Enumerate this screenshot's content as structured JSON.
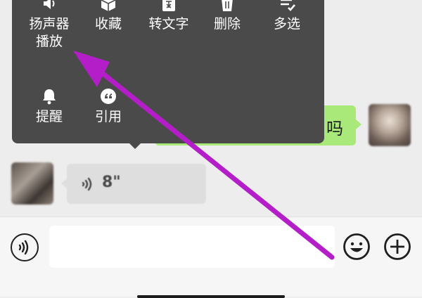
{
  "context_menu": {
    "items": [
      {
        "label": "扬声器\n播放",
        "icon": "speaker-icon"
      },
      {
        "label": "收藏",
        "icon": "cube-icon"
      },
      {
        "label": "转文字",
        "icon": "text-doc-icon"
      },
      {
        "label": "删除",
        "icon": "trash-icon"
      },
      {
        "label": "多选",
        "icon": "checklist-icon"
      },
      {
        "label": "提醒",
        "icon": "bell-icon"
      },
      {
        "label": "引用",
        "icon": "quote-icon"
      }
    ]
  },
  "messages": [
    {
      "side": "right",
      "type": "text",
      "text": "吗"
    },
    {
      "side": "left",
      "type": "voice",
      "duration": "8\""
    }
  ],
  "input_bar": {
    "placeholder": "",
    "left_icon": "voice-toggle-icon",
    "right_icons": [
      "emoji-icon",
      "plus-icon"
    ]
  },
  "colors": {
    "menu_bg": "#4a4a4a",
    "sent_bubble": "#a9e979",
    "received_bubble": "#dedede",
    "annotation_arrow": "#b41ec8"
  }
}
